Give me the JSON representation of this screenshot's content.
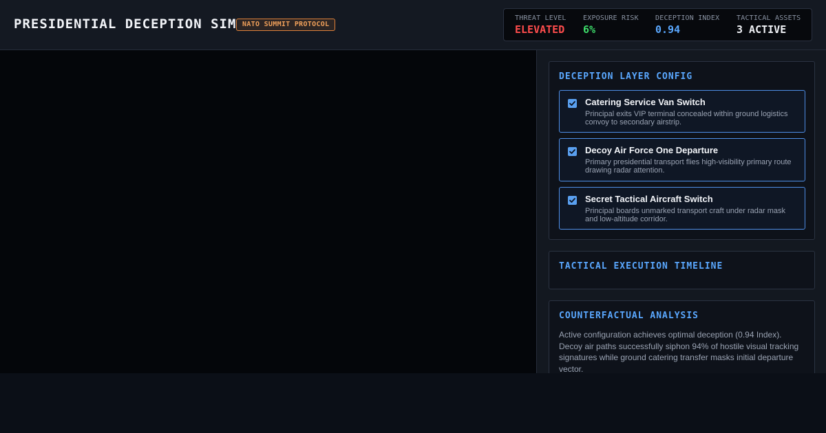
{
  "header": {
    "title": "PRESIDENTIAL DECEPTION SIM",
    "badge": "NATO SUMMIT PROTOCOL",
    "metrics": [
      {
        "label": "THREAT LEVEL",
        "value": "ELEVATED",
        "color": "#ff4d4d"
      },
      {
        "label": "EXPOSURE RISK",
        "value": "6%",
        "color": "#3ddc6a"
      },
      {
        "label": "DECEPTION INDEX",
        "value": "0.94",
        "color": "#5aa8ff"
      },
      {
        "label": "TACTICAL ASSETS",
        "value": "3 ACTIVE",
        "color": "#f2f4f8"
      }
    ]
  },
  "deception_config": {
    "title": "DECEPTION LAYER CONFIG",
    "options": [
      {
        "title": "Catering Service Van Switch",
        "description": "Principal exits VIP terminal concealed within ground logistics convoy to secondary airstrip.",
        "checked": true
      },
      {
        "title": "Decoy Air Force One Departure",
        "description": "Primary presidential transport flies high-visibility primary route drawing radar attention.",
        "checked": true
      },
      {
        "title": "Secret Tactical Aircraft Switch",
        "description": "Principal boards unmarked transport craft under radar mask and low-altitude corridor.",
        "checked": true
      }
    ]
  },
  "timeline": {
    "title": "TACTICAL EXECUTION TIMELINE"
  },
  "analysis": {
    "title": "COUNTERFACTUAL ANALYSIS",
    "text": "Active configuration achieves optimal deception (0.94 Index). Decoy air paths successfully siphon 94% of hostile visual tracking signatures while ground catering transfer masks initial departure vector."
  },
  "colors": {
    "accent": "#5aa8ff",
    "warning": "#e0823a",
    "danger": "#ff4d4d",
    "success": "#3ddc6a"
  }
}
